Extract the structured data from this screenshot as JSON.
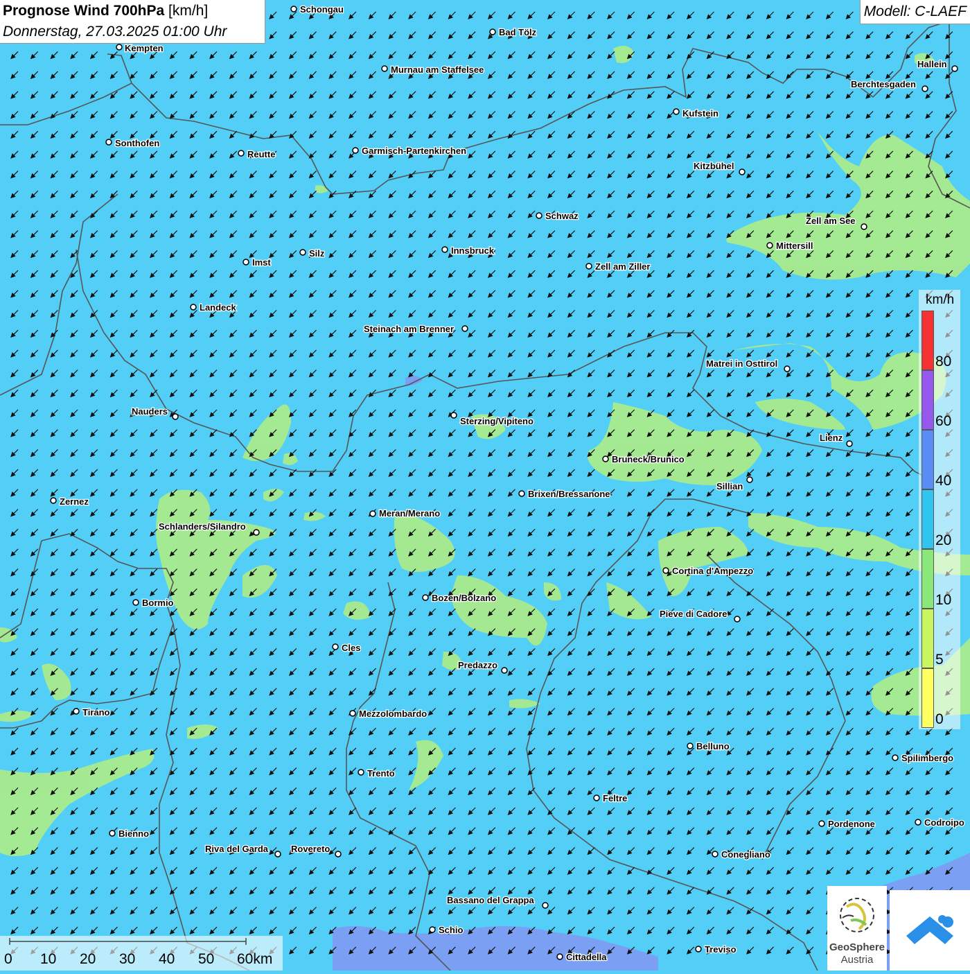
{
  "header": {
    "title_bold": "Prognose Wind 700hPa",
    "title_unit": "[km/h]",
    "datetime": "Donnerstag, 27.03.2025 01:00 Uhr",
    "model": "Modell: C-LAEF"
  },
  "legend": {
    "unit": "km/h",
    "classes": [
      {
        "label": "0",
        "color": "#ffff60"
      },
      {
        "label": "5",
        "color": "#c8f560"
      },
      {
        "label": "10",
        "color": "#8ae87a"
      },
      {
        "label": "20",
        "color": "#30c4f0"
      },
      {
        "label": "40",
        "color": "#5a8cf5"
      },
      {
        "label": "60",
        "color": "#9558ee"
      },
      {
        "label": "80",
        "color": "#f53232"
      }
    ]
  },
  "scale": {
    "labels": [
      "0",
      "10",
      "20",
      "30",
      "40",
      "50",
      "60km"
    ]
  },
  "colors": {
    "background": "#53cff7",
    "calm_zone": "#a9eb8c",
    "strong_zone": "#7f99f2"
  },
  "wind": {
    "direction": "from north-east (arrows pointing south-west)"
  },
  "cities": [
    {
      "name": "Schongau"
    },
    {
      "name": "Bad Tölz"
    },
    {
      "name": "Kempten"
    },
    {
      "name": "Murnau am Staffelsee"
    },
    {
      "name": "Hallein"
    },
    {
      "name": "Berchtesgaden"
    },
    {
      "name": "Kufstein"
    },
    {
      "name": "Sonthofen"
    },
    {
      "name": "Reutte"
    },
    {
      "name": "Garmisch-Partenkirchen"
    },
    {
      "name": "Kitzbühel"
    },
    {
      "name": "Schwaz"
    },
    {
      "name": "Zell am See"
    },
    {
      "name": "Mittersill"
    },
    {
      "name": "Imst"
    },
    {
      "name": "Silz"
    },
    {
      "name": "Innsbruck"
    },
    {
      "name": "Zell am Ziller"
    },
    {
      "name": "Landeck"
    },
    {
      "name": "Steinach am Brenner"
    },
    {
      "name": "Matrei in Osttirol"
    },
    {
      "name": "Nauders"
    },
    {
      "name": "Sterzing/Vipiteno"
    },
    {
      "name": "Lienz"
    },
    {
      "name": "Bruneck/Brunico"
    },
    {
      "name": "Sillian"
    },
    {
      "name": "Brixen/Bressanone"
    },
    {
      "name": "Zernez"
    },
    {
      "name": "Meran/Merano"
    },
    {
      "name": "Schlanders/Silandro"
    },
    {
      "name": "Cortina d'Ampezzo"
    },
    {
      "name": "Bozen/Bolzano"
    },
    {
      "name": "Bormio"
    },
    {
      "name": "Pieve di Cadore"
    },
    {
      "name": "Cles"
    },
    {
      "name": "Predazzo"
    },
    {
      "name": "Tirano"
    },
    {
      "name": "Mezzolombardo"
    },
    {
      "name": "Belluno"
    },
    {
      "name": "Spilimbergo"
    },
    {
      "name": "Trento"
    },
    {
      "name": "Feltre"
    },
    {
      "name": "Pordenone"
    },
    {
      "name": "Codroipo"
    },
    {
      "name": "Bienno"
    },
    {
      "name": "Riva del Garda"
    },
    {
      "name": "Rovereto"
    },
    {
      "name": "Conegliano"
    },
    {
      "name": "Bassano del Grappa"
    },
    {
      "name": "Schio"
    },
    {
      "name": "Treviso"
    },
    {
      "name": "Cittadella"
    }
  ],
  "logos": {
    "geosphere_name": "GeoSphere",
    "geosphere_sub": "Austria"
  }
}
